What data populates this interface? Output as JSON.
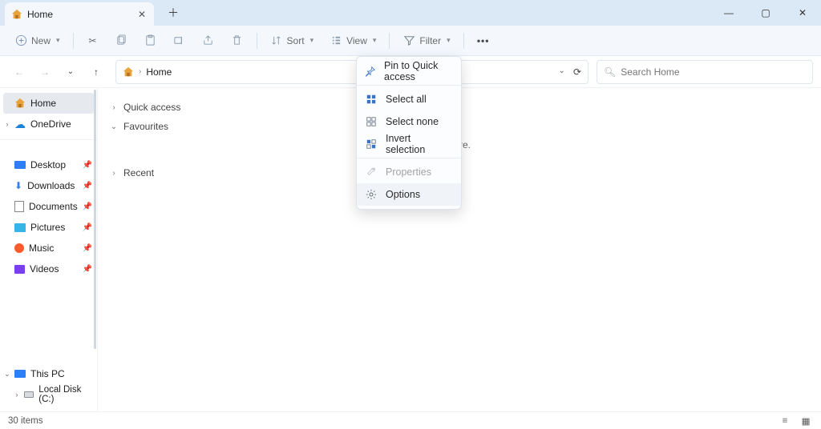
{
  "tab": {
    "title": "Home"
  },
  "toolbar": {
    "new": "New",
    "sort": "Sort",
    "view": "View",
    "filter": "Filter"
  },
  "address": {
    "location": "Home"
  },
  "search": {
    "placeholder": "Search Home"
  },
  "sidebar": {
    "home": "Home",
    "onedrive": "OneDrive",
    "desktop": "Desktop",
    "downloads": "Downloads",
    "documents": "Documents",
    "pictures": "Pictures",
    "music": "Music",
    "videos": "Videos",
    "this_pc": "This PC",
    "local_disk": "Local Disk (C:)"
  },
  "groups": {
    "quick_access": "Quick access",
    "favourites": "Favourites",
    "recent": "Recent"
  },
  "hint": "files, we'll show them here.",
  "menu": {
    "pin": "Pin to Quick access",
    "select_all": "Select all",
    "select_none": "Select none",
    "invert": "Invert selection",
    "properties": "Properties",
    "options": "Options"
  },
  "status": {
    "items": "30 items"
  }
}
